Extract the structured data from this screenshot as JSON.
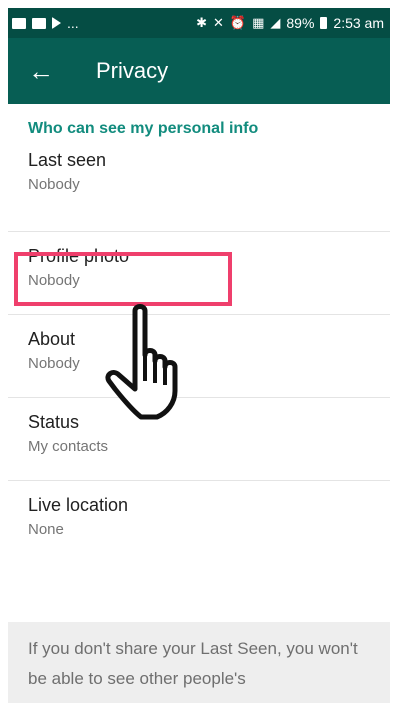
{
  "status_bar": {
    "left_dots": "...",
    "battery": "89%",
    "time": "2:53 am"
  },
  "toolbar": {
    "back_icon": "arrow-back-icon",
    "title": "Privacy"
  },
  "section": {
    "header": "Who can see my personal info"
  },
  "items": [
    {
      "label": "Last seen",
      "value": "Nobody"
    },
    {
      "label": "Profile photo",
      "value": "Nobody"
    },
    {
      "label": "About",
      "value": "Nobody"
    },
    {
      "label": "Status",
      "value": "My contacts"
    },
    {
      "label": "Live location",
      "value": "None"
    }
  ],
  "footer": {
    "text": "If you don't share your Last Seen, you won't be able to see other people's"
  },
  "colors": {
    "toolbar": "#075e54",
    "statusbar": "#054d44",
    "accent": "#128c7e",
    "highlight": "#ef3f6c"
  }
}
